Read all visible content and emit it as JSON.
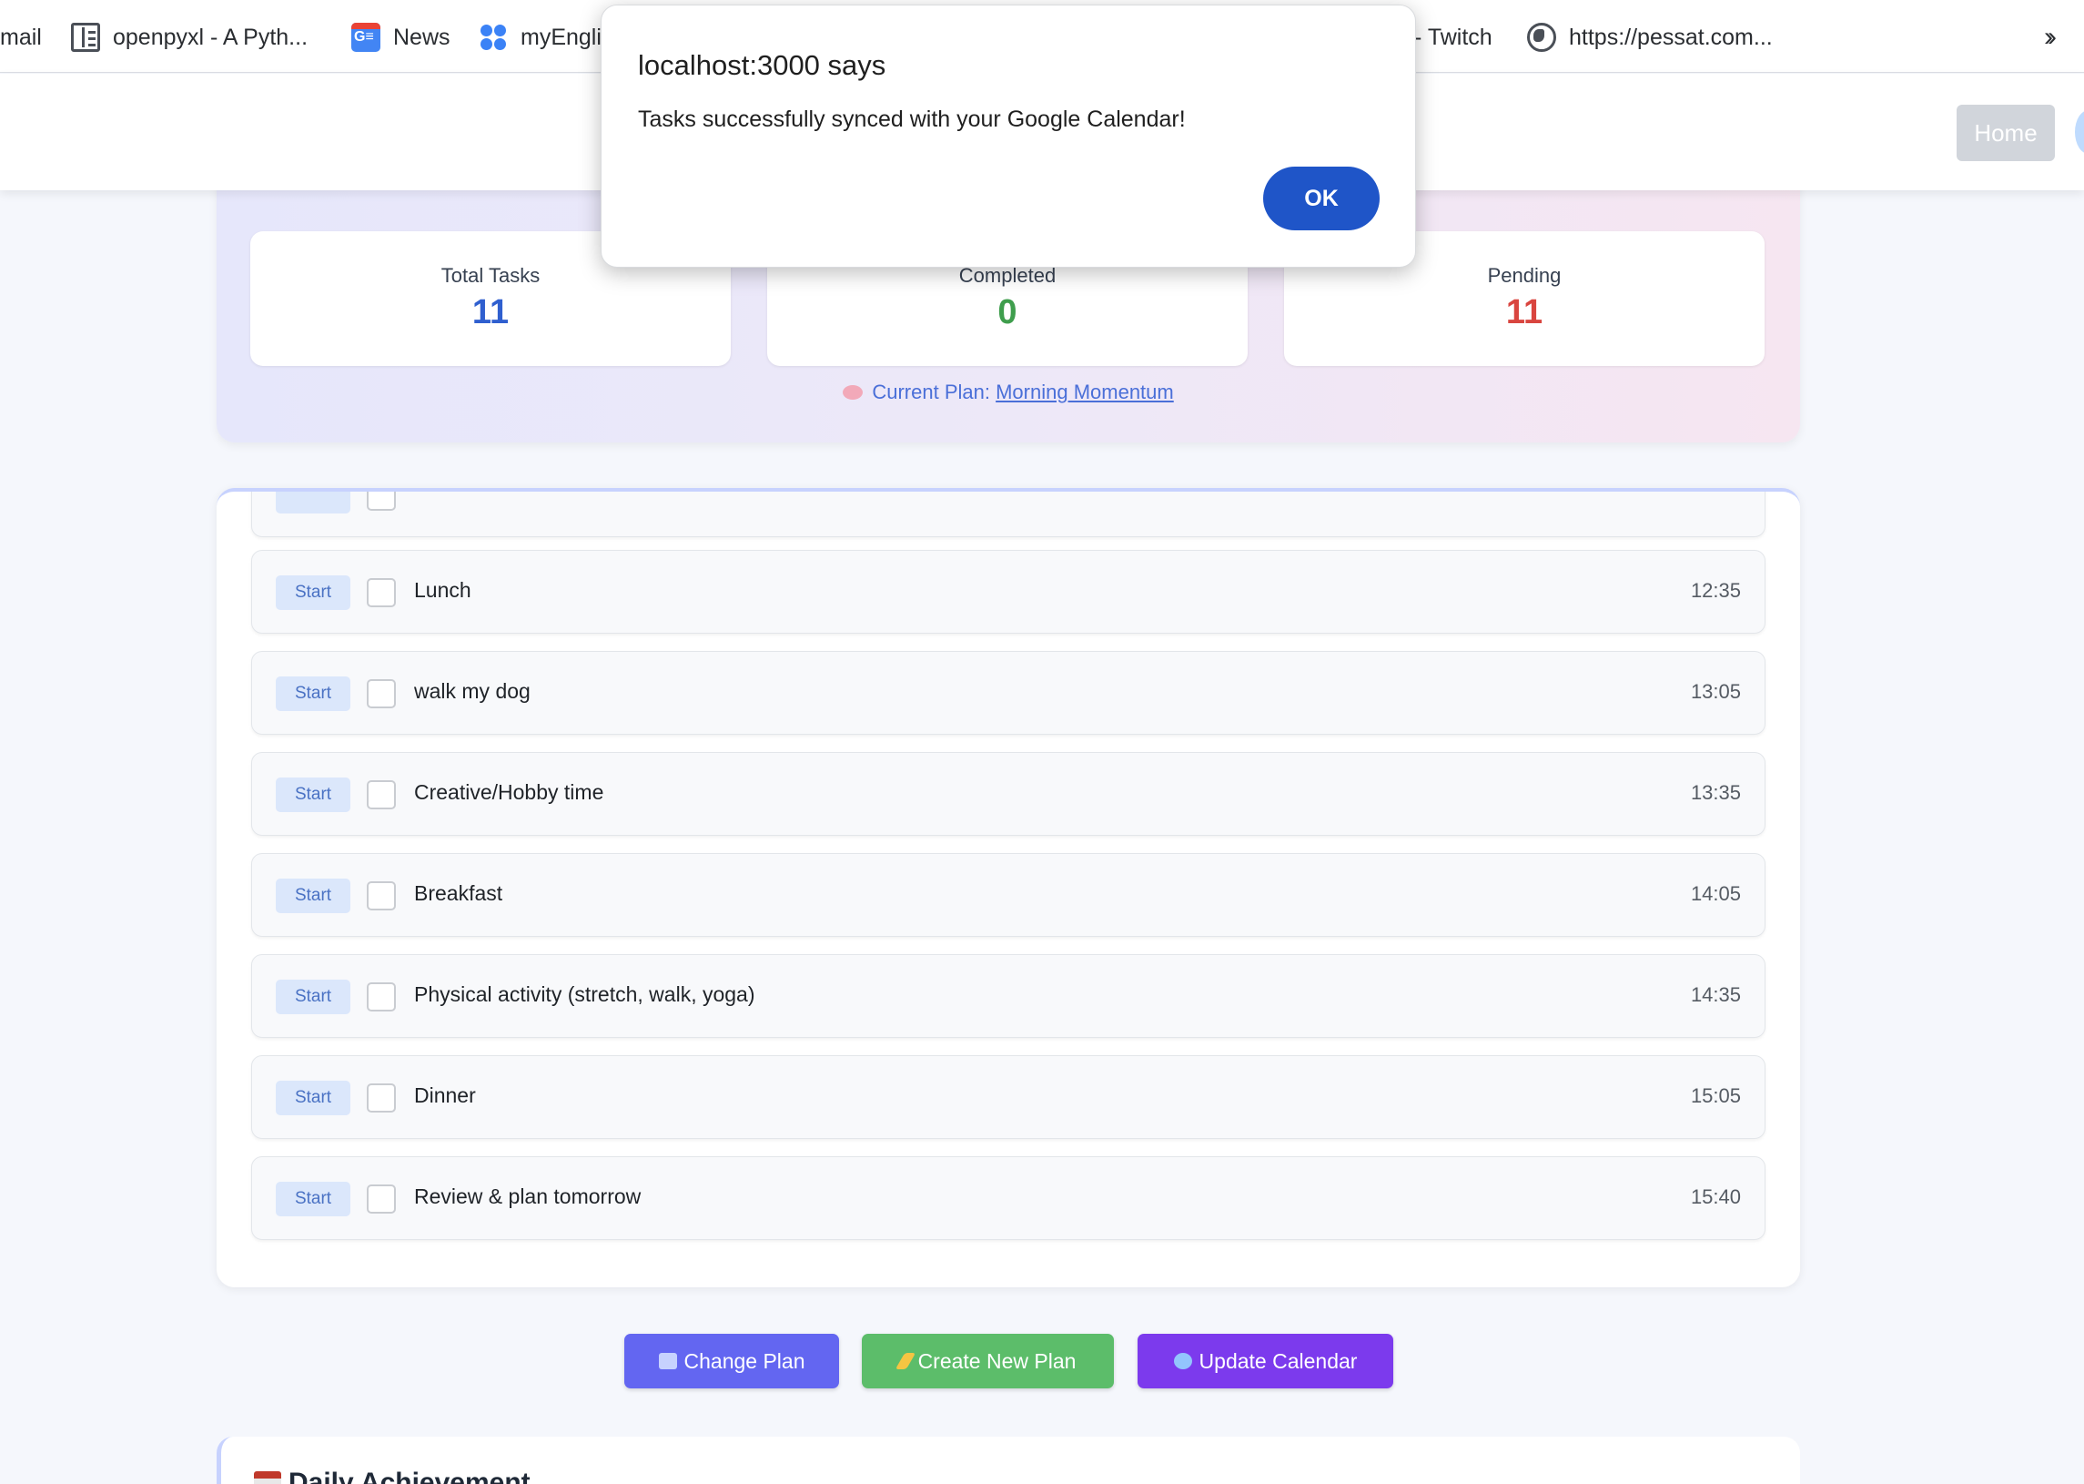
{
  "bookmarks": [
    {
      "label": "mail",
      "icon": "none"
    },
    {
      "label": "openpyxl - A Pyth...",
      "icon": "book-icon"
    },
    {
      "label": "News",
      "icon": "google-news-icon"
    },
    {
      "label": "myEngli",
      "icon": "dots-icon"
    },
    {
      "label": "- Twitch",
      "icon": "none"
    },
    {
      "label": "https://pessat.com...",
      "icon": "globe-icon"
    }
  ],
  "header": {
    "home_label": "Home"
  },
  "dialog": {
    "title": "localhost:3000 says",
    "message": "Tasks successfully synced with your Google Calendar!",
    "ok_label": "OK"
  },
  "summary": {
    "stats": [
      {
        "label": "Total Tasks",
        "value": "11",
        "color": "#2f5fcf"
      },
      {
        "label": "Completed",
        "value": "0",
        "color": "#3f9e4d"
      },
      {
        "label": "Pending",
        "value": "11",
        "color": "#d9453f"
      }
    ],
    "current_plan_prefix": "Current Plan:",
    "current_plan_name": "Morning Momentum"
  },
  "tasks": {
    "start_label": "Start",
    "items": [
      {
        "name": "Lunch",
        "time": "12:35"
      },
      {
        "name": "walk my dog",
        "time": "13:05"
      },
      {
        "name": "Creative/Hobby time",
        "time": "13:35"
      },
      {
        "name": "Breakfast",
        "time": "14:05"
      },
      {
        "name": "Physical activity (stretch, walk, yoga)",
        "time": "14:35"
      },
      {
        "name": "Dinner",
        "time": "15:05"
      },
      {
        "name": "Review & plan tomorrow",
        "time": "15:40"
      }
    ]
  },
  "actions": {
    "change_plan": "Change Plan",
    "create_new_plan": "Create New Plan",
    "update_calendar": "Update Calendar",
    "colors": {
      "change_plan": "#6366f1",
      "create_new_plan": "#5cbd6a",
      "update_calendar": "#7c3aed"
    }
  },
  "achievement": {
    "title": "Daily Achievement"
  }
}
